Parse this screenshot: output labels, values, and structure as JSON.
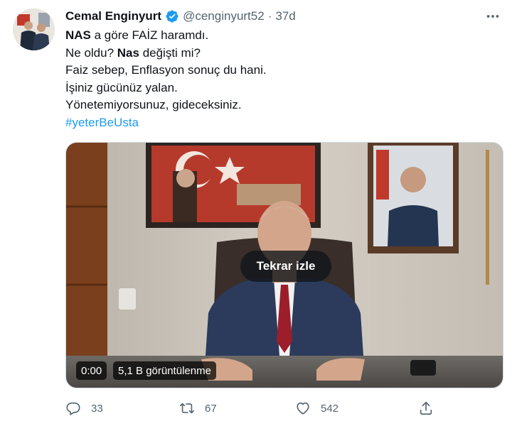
{
  "tweet": {
    "author_name": "Cemal Enginyurt",
    "handle": "@cenginyurt52",
    "separator": "·",
    "time": "37d",
    "lines": [
      {
        "bold": "NAS",
        "rest": " a göre FAİZ haramdı."
      },
      {
        "pre": "Ne oldu? ",
        "bold": "Nas",
        "rest": " değişti mi?"
      },
      {
        "text": "Faiz sebep, Enflasyon sonuç du hani."
      },
      {
        "text": "İşiniz gücünüz yalan."
      },
      {
        "text": "Yönetemiyorsunuz, gideceksiniz."
      }
    ],
    "hashtag": "#yeterBeUsta"
  },
  "video": {
    "replay_label": "Tekrar izle",
    "time": "0:00",
    "views": "5,1 B görüntülenme"
  },
  "actions": {
    "replies": "33",
    "retweets": "67",
    "likes": "542"
  },
  "colors": {
    "accent": "#1d9bf0",
    "secondary_text": "#536471",
    "primary_text": "#0f1419"
  },
  "icons": [
    "verified-badge-icon",
    "more-icon",
    "reply-icon",
    "retweet-icon",
    "like-icon",
    "share-icon"
  ]
}
